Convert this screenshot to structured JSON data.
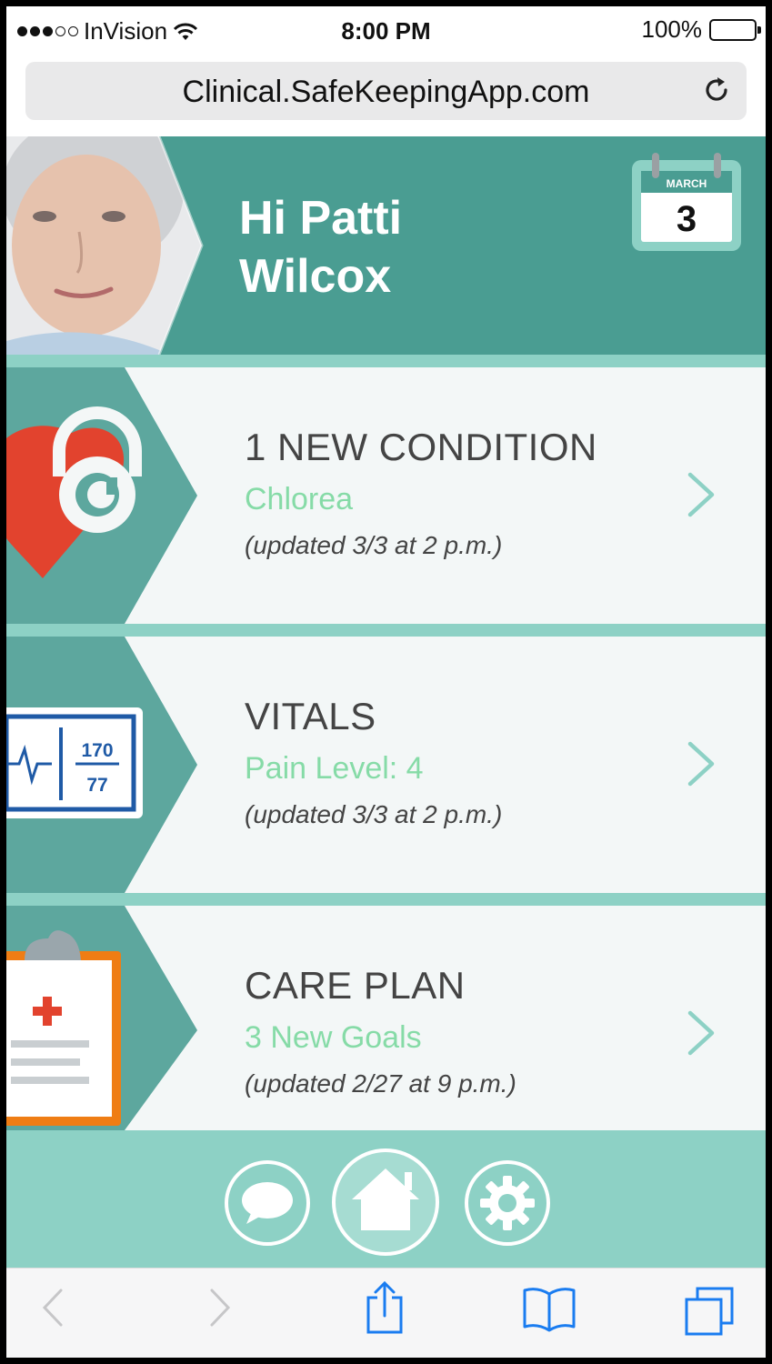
{
  "status_bar": {
    "carrier": "InVision",
    "time": "8:00 PM",
    "battery": "100%"
  },
  "browser": {
    "url": "Clinical.SafeKeepingApp.com"
  },
  "header": {
    "greeting_line1": "Hi Patti",
    "greeting_line2": "Wilcox",
    "calendar_month": "MARCH",
    "calendar_day": "3"
  },
  "cards": [
    {
      "title": "1 NEW CONDITION",
      "subtitle": "Chlorea",
      "updated": "(updated 3/3 at 2 p.m.)"
    },
    {
      "title": "VITALS",
      "subtitle": "Pain Level: 4",
      "updated": "(updated 3/3 at 2 p.m.)",
      "bp_systolic": "170",
      "bp_diastolic": "77"
    },
    {
      "title": "CARE PLAN",
      "subtitle": "3 New Goals",
      "updated": "(updated 2/27 at 9 p.m.)"
    }
  ],
  "colors": {
    "header_teal": "#4a9d92",
    "light_teal": "#8dd1c5",
    "accent_green": "#86dba7",
    "chevron": "#8dd1c5",
    "safari_blue": "#1a7cf0"
  },
  "icons": {
    "app_nav": [
      "chat-icon",
      "home-icon",
      "gear-icon"
    ],
    "toolbar": [
      "back-icon",
      "forward-icon",
      "share-icon",
      "bookmarks-icon",
      "tabs-icon"
    ]
  }
}
